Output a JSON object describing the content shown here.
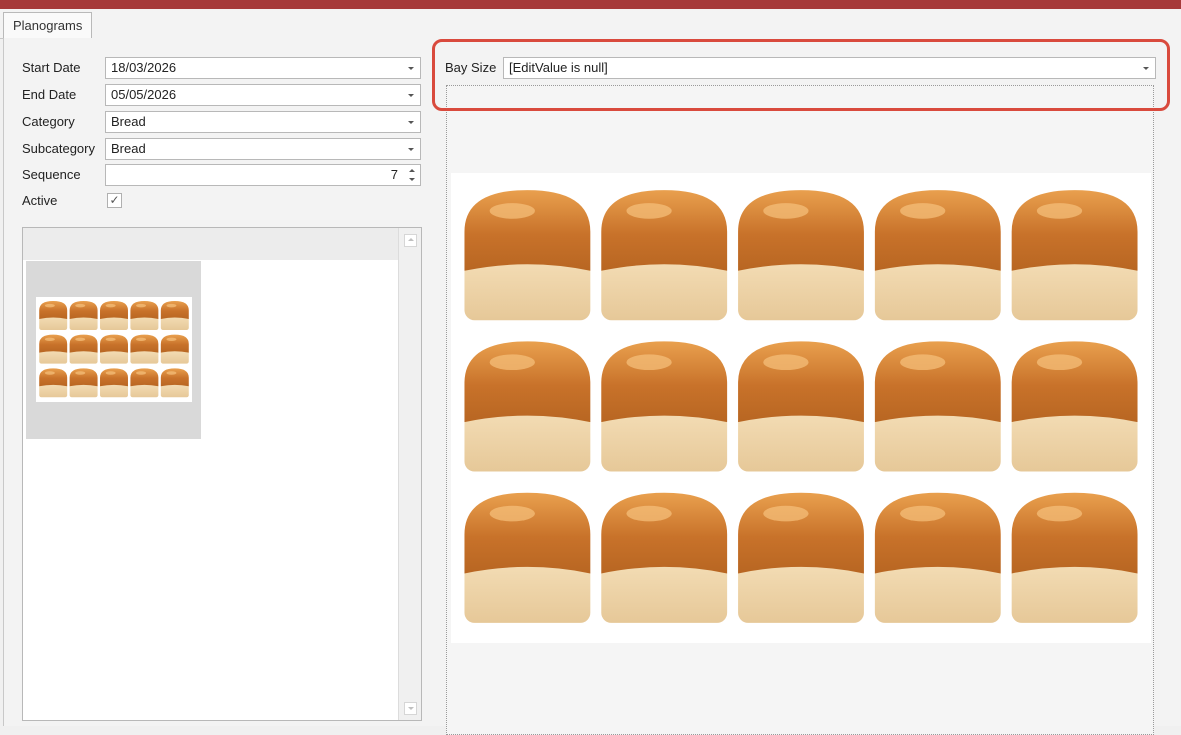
{
  "tabs": [
    {
      "label": "Planograms"
    }
  ],
  "form": {
    "start_date": {
      "label": "Start Date",
      "value": "18/03/2026"
    },
    "end_date": {
      "label": "End Date",
      "value": "05/05/2026"
    },
    "category": {
      "label": "Category",
      "value": "Bread"
    },
    "subcategory": {
      "label": "Subcategory",
      "value": "Bread"
    },
    "sequence": {
      "label": "Sequence",
      "value": "7"
    },
    "active": {
      "label": "Active",
      "checked": true,
      "check_glyph": "✓"
    }
  },
  "bay_size": {
    "label": "Bay Size",
    "value": "[EditValue is null]"
  },
  "image_content": {
    "rows": 3,
    "columns": 5,
    "subject": "bread-loaf"
  },
  "colors": {
    "title_bar": "#a63a3a",
    "highlight": "#d94a3d"
  }
}
